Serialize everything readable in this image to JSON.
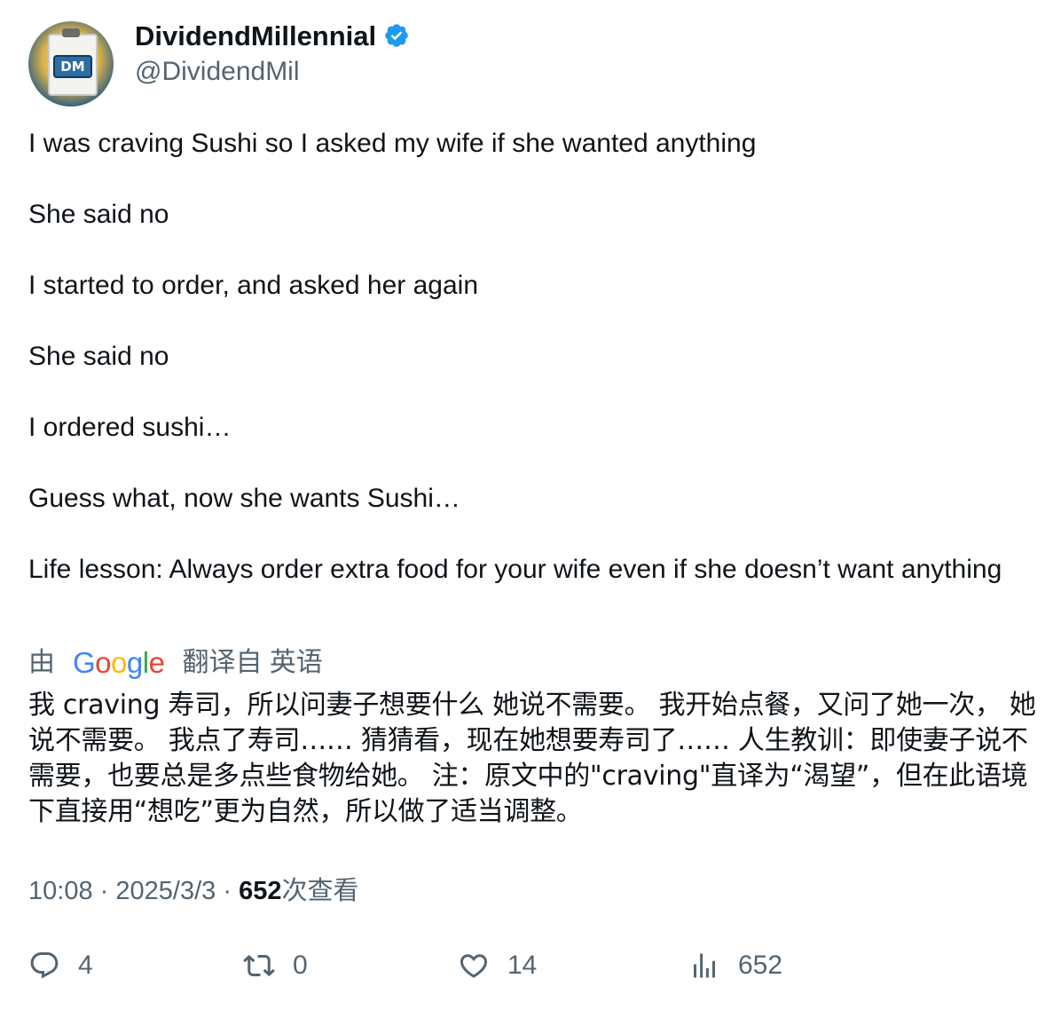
{
  "author": {
    "display_name": "DividendMillennial",
    "handle": "@DividendMil",
    "avatar_text": "DM",
    "verified": true
  },
  "tweet": {
    "paragraphs": [
      "I was craving Sushi so I asked my wife if she wanted anything",
      "She said no",
      "I started to order, and asked her again",
      "She said no",
      "I ordered sushi…",
      "Guess what, now she wants Sushi…",
      "Life lesson:  Always order extra food for your wife even if she doesn’t want anything"
    ]
  },
  "translation": {
    "prefix": "由",
    "provider": "Google",
    "suffix": "翻译自 英语",
    "text": "我 craving 寿司，所以问妻子想要什么 她说不需要。 我开始点餐，又问了她一次， 她说不需要。 我点了寿司…… 猜猜看，现在她想要寿司了…… 人生教训：即使妻子说不需要，也要总是多点些食物给她。 注：原文中的\"craving\"直译为“渴望”，但在此语境下直接用“想吃”更为自然，所以做了适当调整。"
  },
  "meta": {
    "time": "10:08",
    "separator": "·",
    "date": "2025/3/3",
    "views": "652",
    "views_label": "次查看"
  },
  "actions": {
    "replies": "4",
    "retweets": "0",
    "likes": "14",
    "views": "652"
  },
  "colors": {
    "text": "#0f1419",
    "secondary": "#536471",
    "verified": "#1d9bf0"
  },
  "icons": [
    "verified-badge-icon",
    "reply-icon",
    "retweet-icon",
    "like-icon",
    "views-icon"
  ]
}
